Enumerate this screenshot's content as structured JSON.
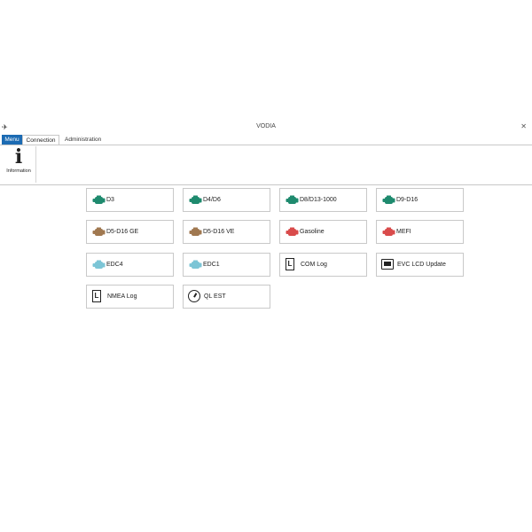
{
  "window": {
    "title": "VODIA"
  },
  "ribbon": {
    "tabs": [
      {
        "label": "Menu"
      },
      {
        "label": "Connection"
      },
      {
        "label": "Administration"
      }
    ],
    "information": {
      "glyph": "i",
      "label": "Information"
    }
  },
  "colors": {
    "menu_tab": "#1c6bb3",
    "engine_green": "#1e8a6e",
    "engine_brown": "#a07850",
    "engine_red": "#d94b4b",
    "engine_lightblue": "#7cc5d6"
  },
  "tiles": [
    {
      "label": "D3",
      "icon": "engine-icon",
      "color": "#1e8a6e"
    },
    {
      "label": "D4/D6",
      "icon": "engine-icon",
      "color": "#1e8a6e"
    },
    {
      "label": "D8/D13-1000",
      "icon": "engine-icon",
      "color": "#1e8a6e"
    },
    {
      "label": "D9-D16",
      "icon": "engine-icon",
      "color": "#1e8a6e"
    },
    {
      "label": "D5-D16 GE",
      "icon": "engine-icon",
      "color": "#a07850"
    },
    {
      "label": "D5-D16 VE",
      "icon": "engine-icon",
      "color": "#a07850"
    },
    {
      "label": "Gasoline",
      "icon": "engine-icon",
      "color": "#d94b4b"
    },
    {
      "label": "MEFI",
      "icon": "engine-icon",
      "color": "#d94b4b"
    },
    {
      "label": "EDC4",
      "icon": "engine-icon",
      "color": "#7cc5d6"
    },
    {
      "label": "EDC1",
      "icon": "engine-icon",
      "color": "#7cc5d6"
    },
    {
      "label": "COM Log",
      "icon": "log-icon",
      "glyph": "L"
    },
    {
      "label": "EVC LCD Update",
      "icon": "monitor-icon"
    },
    {
      "label": "NMEA Log",
      "icon": "log-icon",
      "glyph": "L"
    },
    {
      "label": "QL EST",
      "icon": "gauge-icon"
    }
  ]
}
